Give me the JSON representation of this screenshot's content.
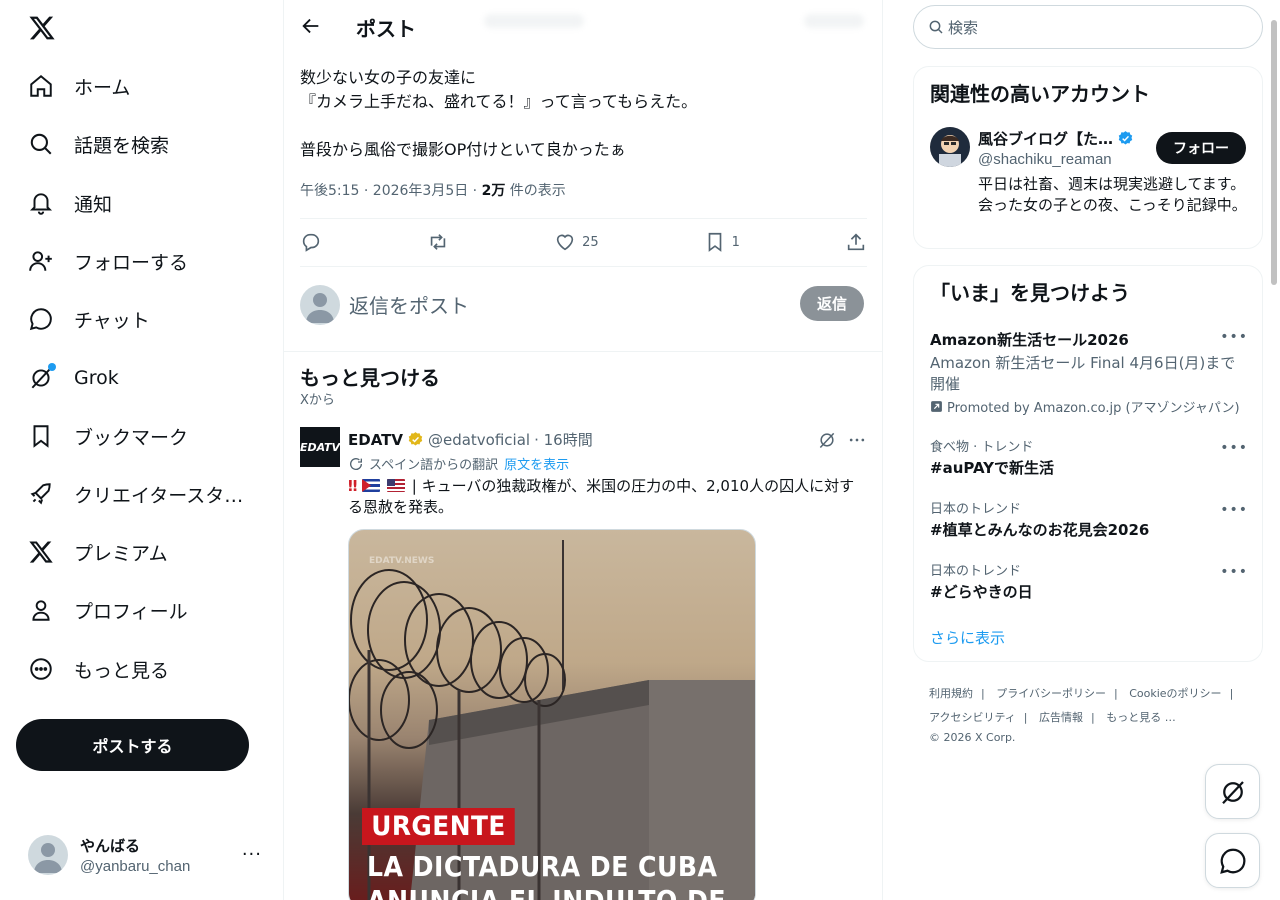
{
  "nav": {
    "items": [
      {
        "label": "ホーム",
        "icon": "home-icon"
      },
      {
        "label": "話題を検索",
        "icon": "search-icon"
      },
      {
        "label": "通知",
        "icon": "bell-icon"
      },
      {
        "label": "フォローする",
        "icon": "person-plus-icon"
      },
      {
        "label": "チャット",
        "icon": "chat-icon"
      },
      {
        "label": "Grok",
        "icon": "grok-icon"
      },
      {
        "label": "ブックマーク",
        "icon": "bookmark-icon"
      },
      {
        "label": "クリエイタースタ…",
        "icon": "rocket-icon"
      },
      {
        "label": "プレミアム",
        "icon": "x-premium-icon"
      },
      {
        "label": "プロフィール",
        "icon": "person-icon"
      },
      {
        "label": "もっと見る",
        "icon": "more-circle-icon"
      }
    ],
    "post_button": "ポストする",
    "account": {
      "display_name": "やんばる",
      "handle": "@yanbaru_chan",
      "more": "···"
    }
  },
  "header": {
    "title": "ポスト"
  },
  "tweet": {
    "text": "数少ない女の子の友達に\n『カメラ上手だね、盛れてる！』って言ってもらえた。\n\n普段から風俗で撮影OP付けといて良かったぁ",
    "meta_prefix": "午後5:15 · 2026年3月5日 · ",
    "views": "2万",
    "views_suffix": " 件の表示",
    "likes": "25",
    "bookmarks": "1"
  },
  "reply": {
    "placeholder": "返信をポスト",
    "button": "返信"
  },
  "discover": {
    "title": "もっと見つける",
    "subtitle": "Xから",
    "card": {
      "avatar_text": "EDATV",
      "name": "EDATV",
      "handle": "@edatvoficial",
      "time": "· 16時間",
      "translation": "スペイン語からの翻訳",
      "show_original": "原文を表示",
      "text": "| キューバの独裁政権が、米国の圧力の中、2,010人の囚人に対する恩赦を発表。",
      "media": {
        "badge": "URGENTE",
        "headline": "LA DICTADURA DE CUBA\nANUNCIA EL INDULTO DE"
      }
    }
  },
  "search": {
    "placeholder": "検索"
  },
  "related": {
    "title": "関連性の高いアカウント",
    "name": "風谷ブイログ【た…",
    "handle": "@shachiku_reaman",
    "follow": "フォロー",
    "bio": "平日は社畜、週末は現実逃避してます。会った女の子との夜、こっそり記録中。"
  },
  "trends": {
    "title": "「いま」を見つけよう",
    "promoted": {
      "title": "Amazon新生活セール2026",
      "desc": "Amazon 新生活セール Final 4月6日(月)まで開催",
      "by": "Promoted by Amazon.co.jp (アマゾンジャパン)"
    },
    "items": [
      {
        "sub": "食べ物 · トレンド",
        "title": "#auPAYで新生活"
      },
      {
        "sub": "日本のトレンド",
        "title": "#植草とみんなのお花見会2026"
      },
      {
        "sub": "日本のトレンド",
        "title": "#どらやきの日"
      }
    ],
    "more": "さらに表示"
  },
  "footer": {
    "links": [
      "利用規約",
      "プライバシーポリシー",
      "Cookieのポリシー",
      "アクセシビリティ",
      "広告情報",
      "もっと見る …"
    ],
    "copyright": "© 2026 X Corp."
  },
  "colors": {
    "accent": "#1d9bf0",
    "text": "#0f1419",
    "muted": "#536471",
    "verified_gold": "#e2b719"
  }
}
